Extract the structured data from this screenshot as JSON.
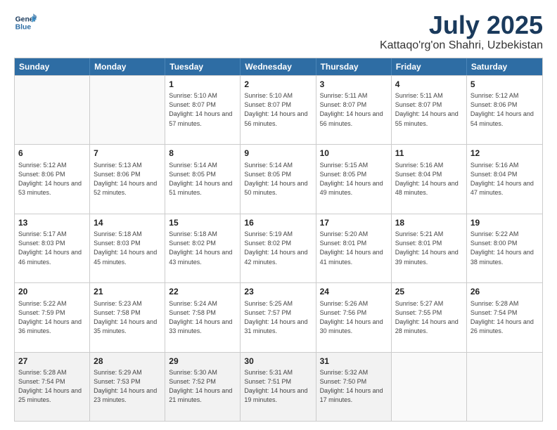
{
  "logo": {
    "line1": "General",
    "line2": "Blue"
  },
  "title": "July 2025",
  "location": "Kattaqo'rg'on Shahri, Uzbekistan",
  "weekdays": [
    "Sunday",
    "Monday",
    "Tuesday",
    "Wednesday",
    "Thursday",
    "Friday",
    "Saturday"
  ],
  "weeks": [
    [
      {
        "day": "",
        "sunrise": "",
        "sunset": "",
        "daylight": "",
        "empty": true
      },
      {
        "day": "",
        "sunrise": "",
        "sunset": "",
        "daylight": "",
        "empty": true
      },
      {
        "day": "1",
        "sunrise": "Sunrise: 5:10 AM",
        "sunset": "Sunset: 8:07 PM",
        "daylight": "Daylight: 14 hours and 57 minutes."
      },
      {
        "day": "2",
        "sunrise": "Sunrise: 5:10 AM",
        "sunset": "Sunset: 8:07 PM",
        "daylight": "Daylight: 14 hours and 56 minutes."
      },
      {
        "day": "3",
        "sunrise": "Sunrise: 5:11 AM",
        "sunset": "Sunset: 8:07 PM",
        "daylight": "Daylight: 14 hours and 56 minutes."
      },
      {
        "day": "4",
        "sunrise": "Sunrise: 5:11 AM",
        "sunset": "Sunset: 8:07 PM",
        "daylight": "Daylight: 14 hours and 55 minutes."
      },
      {
        "day": "5",
        "sunrise": "Sunrise: 5:12 AM",
        "sunset": "Sunset: 8:06 PM",
        "daylight": "Daylight: 14 hours and 54 minutes."
      }
    ],
    [
      {
        "day": "6",
        "sunrise": "Sunrise: 5:12 AM",
        "sunset": "Sunset: 8:06 PM",
        "daylight": "Daylight: 14 hours and 53 minutes."
      },
      {
        "day": "7",
        "sunrise": "Sunrise: 5:13 AM",
        "sunset": "Sunset: 8:06 PM",
        "daylight": "Daylight: 14 hours and 52 minutes."
      },
      {
        "day": "8",
        "sunrise": "Sunrise: 5:14 AM",
        "sunset": "Sunset: 8:05 PM",
        "daylight": "Daylight: 14 hours and 51 minutes."
      },
      {
        "day": "9",
        "sunrise": "Sunrise: 5:14 AM",
        "sunset": "Sunset: 8:05 PM",
        "daylight": "Daylight: 14 hours and 50 minutes."
      },
      {
        "day": "10",
        "sunrise": "Sunrise: 5:15 AM",
        "sunset": "Sunset: 8:05 PM",
        "daylight": "Daylight: 14 hours and 49 minutes."
      },
      {
        "day": "11",
        "sunrise": "Sunrise: 5:16 AM",
        "sunset": "Sunset: 8:04 PM",
        "daylight": "Daylight: 14 hours and 48 minutes."
      },
      {
        "day": "12",
        "sunrise": "Sunrise: 5:16 AM",
        "sunset": "Sunset: 8:04 PM",
        "daylight": "Daylight: 14 hours and 47 minutes."
      }
    ],
    [
      {
        "day": "13",
        "sunrise": "Sunrise: 5:17 AM",
        "sunset": "Sunset: 8:03 PM",
        "daylight": "Daylight: 14 hours and 46 minutes."
      },
      {
        "day": "14",
        "sunrise": "Sunrise: 5:18 AM",
        "sunset": "Sunset: 8:03 PM",
        "daylight": "Daylight: 14 hours and 45 minutes."
      },
      {
        "day": "15",
        "sunrise": "Sunrise: 5:18 AM",
        "sunset": "Sunset: 8:02 PM",
        "daylight": "Daylight: 14 hours and 43 minutes."
      },
      {
        "day": "16",
        "sunrise": "Sunrise: 5:19 AM",
        "sunset": "Sunset: 8:02 PM",
        "daylight": "Daylight: 14 hours and 42 minutes."
      },
      {
        "day": "17",
        "sunrise": "Sunrise: 5:20 AM",
        "sunset": "Sunset: 8:01 PM",
        "daylight": "Daylight: 14 hours and 41 minutes."
      },
      {
        "day": "18",
        "sunrise": "Sunrise: 5:21 AM",
        "sunset": "Sunset: 8:01 PM",
        "daylight": "Daylight: 14 hours and 39 minutes."
      },
      {
        "day": "19",
        "sunrise": "Sunrise: 5:22 AM",
        "sunset": "Sunset: 8:00 PM",
        "daylight": "Daylight: 14 hours and 38 minutes."
      }
    ],
    [
      {
        "day": "20",
        "sunrise": "Sunrise: 5:22 AM",
        "sunset": "Sunset: 7:59 PM",
        "daylight": "Daylight: 14 hours and 36 minutes."
      },
      {
        "day": "21",
        "sunrise": "Sunrise: 5:23 AM",
        "sunset": "Sunset: 7:58 PM",
        "daylight": "Daylight: 14 hours and 35 minutes."
      },
      {
        "day": "22",
        "sunrise": "Sunrise: 5:24 AM",
        "sunset": "Sunset: 7:58 PM",
        "daylight": "Daylight: 14 hours and 33 minutes."
      },
      {
        "day": "23",
        "sunrise": "Sunrise: 5:25 AM",
        "sunset": "Sunset: 7:57 PM",
        "daylight": "Daylight: 14 hours and 31 minutes."
      },
      {
        "day": "24",
        "sunrise": "Sunrise: 5:26 AM",
        "sunset": "Sunset: 7:56 PM",
        "daylight": "Daylight: 14 hours and 30 minutes."
      },
      {
        "day": "25",
        "sunrise": "Sunrise: 5:27 AM",
        "sunset": "Sunset: 7:55 PM",
        "daylight": "Daylight: 14 hours and 28 minutes."
      },
      {
        "day": "26",
        "sunrise": "Sunrise: 5:28 AM",
        "sunset": "Sunset: 7:54 PM",
        "daylight": "Daylight: 14 hours and 26 minutes."
      }
    ],
    [
      {
        "day": "27",
        "sunrise": "Sunrise: 5:28 AM",
        "sunset": "Sunset: 7:54 PM",
        "daylight": "Daylight: 14 hours and 25 minutes."
      },
      {
        "day": "28",
        "sunrise": "Sunrise: 5:29 AM",
        "sunset": "Sunset: 7:53 PM",
        "daylight": "Daylight: 14 hours and 23 minutes."
      },
      {
        "day": "29",
        "sunrise": "Sunrise: 5:30 AM",
        "sunset": "Sunset: 7:52 PM",
        "daylight": "Daylight: 14 hours and 21 minutes."
      },
      {
        "day": "30",
        "sunrise": "Sunrise: 5:31 AM",
        "sunset": "Sunset: 7:51 PM",
        "daylight": "Daylight: 14 hours and 19 minutes."
      },
      {
        "day": "31",
        "sunrise": "Sunrise: 5:32 AM",
        "sunset": "Sunset: 7:50 PM",
        "daylight": "Daylight: 14 hours and 17 minutes."
      },
      {
        "day": "",
        "sunrise": "",
        "sunset": "",
        "daylight": "",
        "empty": true
      },
      {
        "day": "",
        "sunrise": "",
        "sunset": "",
        "daylight": "",
        "empty": true
      }
    ]
  ]
}
